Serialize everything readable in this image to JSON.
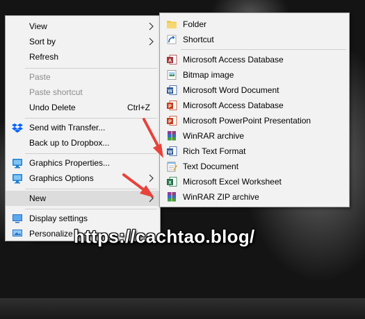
{
  "context_menu": {
    "items": [
      {
        "label": "View",
        "submenu": true
      },
      {
        "label": "Sort by",
        "submenu": true
      },
      {
        "label": "Refresh"
      },
      {
        "label": "Paste",
        "disabled": true
      },
      {
        "label": "Paste shortcut",
        "disabled": true
      },
      {
        "label": "Undo Delete",
        "shortcut": "Ctrl+Z"
      },
      {
        "label": "Send with Transfer...",
        "icon": "dropbox-icon"
      },
      {
        "label": "Back up to Dropbox..."
      },
      {
        "label": "Graphics Properties...",
        "icon": "intel-graphics-icon"
      },
      {
        "label": "Graphics Options",
        "icon": "intel-graphics-icon",
        "submenu": true
      },
      {
        "label": "New",
        "submenu": true,
        "highlighted": true
      },
      {
        "label": "Display settings",
        "icon": "display-icon"
      },
      {
        "label": "Personalize",
        "icon": "personalize-icon"
      }
    ]
  },
  "new_submenu": {
    "items": [
      {
        "label": "Folder",
        "icon": "folder-icon"
      },
      {
        "label": "Shortcut",
        "icon": "shortcut-icon"
      },
      {
        "label": "Microsoft Access Database",
        "icon": "access-icon"
      },
      {
        "label": "Bitmap image",
        "icon": "bitmap-icon"
      },
      {
        "label": "Microsoft Word Document",
        "icon": "word-icon"
      },
      {
        "label": "Microsoft Access Database",
        "icon": "powerpoint-icon"
      },
      {
        "label": "Microsoft PowerPoint Presentation",
        "icon": "powerpoint-icon"
      },
      {
        "label": "WinRAR archive",
        "icon": "winrar-icon"
      },
      {
        "label": "Rich Text Format",
        "icon": "word-icon"
      },
      {
        "label": "Text Document",
        "icon": "notepad-icon"
      },
      {
        "label": "Microsoft Excel Worksheet",
        "icon": "excel-icon"
      },
      {
        "label": "WinRAR ZIP archive",
        "icon": "winrar-icon"
      }
    ]
  },
  "watermark": "https://cachtao.blog/",
  "colors": {
    "menu_bg": "#f2f2f2",
    "hover": "#dcdcdc",
    "disabled_text": "#8c8c8c",
    "annotation_arrow": "#e8423a"
  }
}
